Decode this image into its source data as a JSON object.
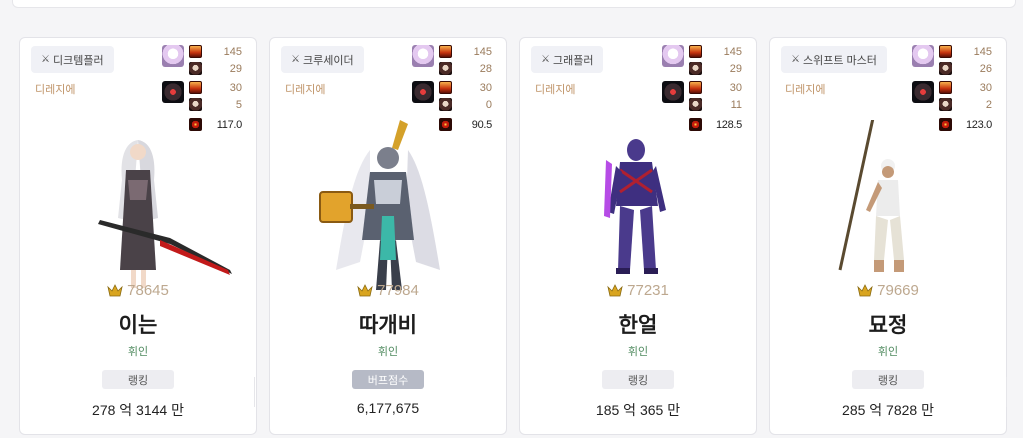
{
  "colors": {
    "page_background": "#f5f5f7",
    "server": "#c0956a",
    "guild": "#4f8a5f",
    "fame": "#bda88f",
    "buff_badge": "#b6bac6"
  },
  "cards": [
    {
      "job": "디크템플러",
      "server": "디레지에",
      "stats": [
        "145",
        "29",
        "30",
        "5"
      ],
      "score": "117.0",
      "fame": "78645",
      "name": "이는",
      "guild": "휘인",
      "badge": "랭킹",
      "badge_style": "ranking",
      "value": "278 억 3144 만"
    },
    {
      "job": "크루세이더",
      "server": "디레지에",
      "stats": [
        "145",
        "28",
        "30",
        "0"
      ],
      "score": "90.5",
      "fame": "77984",
      "name": "따개비",
      "guild": "휘인",
      "badge": "버프점수",
      "badge_style": "buff",
      "value": "6,177,675"
    },
    {
      "job": "그래플러",
      "server": "디레지에",
      "stats": [
        "145",
        "29",
        "30",
        "11"
      ],
      "score": "128.5",
      "fame": "77231",
      "name": "한얼",
      "guild": "휘인",
      "badge": "랭킹",
      "badge_style": "ranking",
      "value": "185 억 365 만"
    },
    {
      "job": "스위프트 마스터",
      "server": "디레지에",
      "stats": [
        "145",
        "26",
        "30",
        "2"
      ],
      "score": "123.0",
      "fame": "79669",
      "name": "묘정",
      "guild": "휘인",
      "badge": "랭킹",
      "badge_style": "ranking",
      "value": "285 억 7828 만"
    }
  ]
}
